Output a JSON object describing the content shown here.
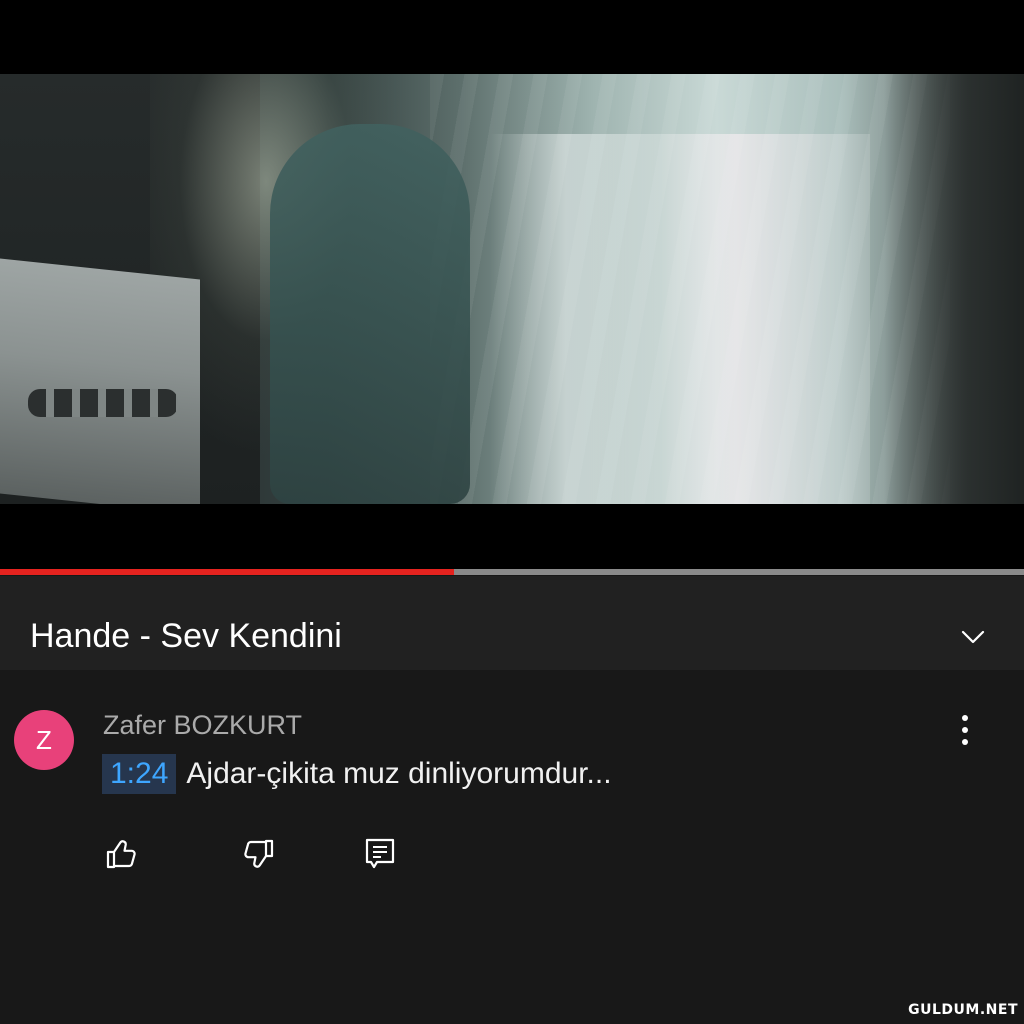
{
  "player": {
    "progress_fraction": 0.443,
    "progress_color": "#e5231f",
    "track_color": "#8a8a8a"
  },
  "video": {
    "title": "Hande - Sev Kendini",
    "expand_icon": "chevron-down-icon"
  },
  "comment": {
    "avatar_letter": "Z",
    "avatar_color": "#e8417a",
    "author": "Zafer BOZKURT",
    "timestamp_link": "1:24",
    "text": "Ajdar-çikita muz dinliyorumdur...",
    "menu_icon": "more-vert-icon",
    "actions": {
      "like_icon": "thumb-up-icon",
      "dislike_icon": "thumb-down-icon",
      "reply_icon": "comment-reply-icon"
    }
  },
  "watermark": "GULDUM.NET"
}
